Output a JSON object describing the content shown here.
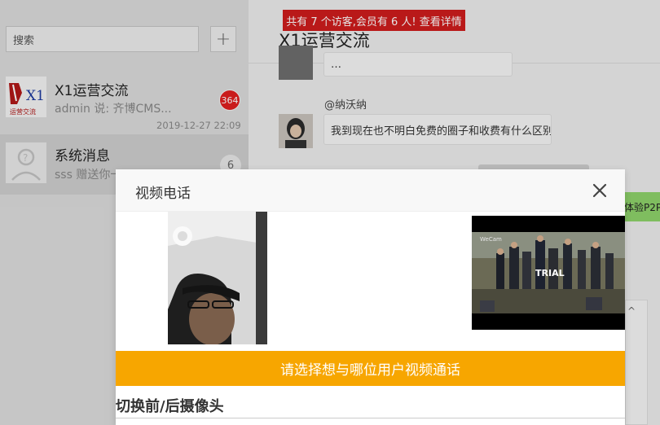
{
  "sidebar": {
    "search_placeholder": "搜索",
    "add_label": "+",
    "conversations": [
      {
        "name": "X1运营交流",
        "preview": "admin 说: 齐博CMS...",
        "time": "2019-12-27 22:09",
        "badge": "364",
        "avatar_text_big": "X1",
        "avatar_text_small": "运营交流"
      },
      {
        "name": "系统消息",
        "preview": "sss 赠送你一",
        "badge": "6"
      }
    ]
  },
  "chat": {
    "title": "X1运营交流",
    "messages": [
      {
        "text": "…"
      },
      {
        "sender": "@纳沃纳",
        "text": "我到现在也不明白免费的圈子和收费有什么区别"
      }
    ],
    "green_note": "体验P2P"
  },
  "banner": "共有 7 个访客,会员有 6 人! 查看详情",
  "modal": {
    "title": "视频电话",
    "close_icon": "close-icon",
    "remote_overlay_logo": "WeCam",
    "remote_overlay_text": "TRIAL",
    "cta": "请选择想与哪位用户视频通话",
    "switch_camera": "切换前/后摄像头",
    "device_text": "…"
  },
  "colors": {
    "badge_red": "#e02020",
    "cta_orange": "#f7a600",
    "banner_red": "#cf1c1c",
    "green_note": "#8ed36a"
  }
}
